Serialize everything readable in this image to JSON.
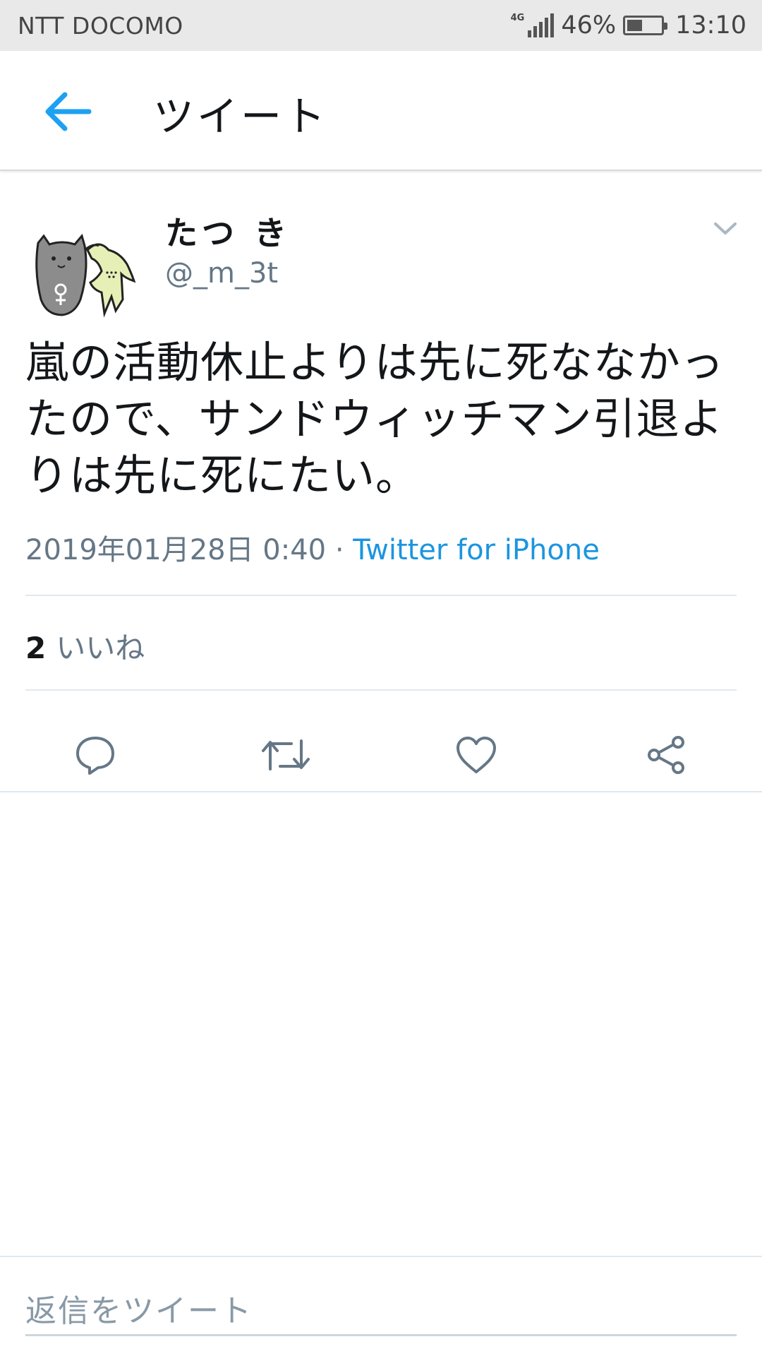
{
  "status_bar": {
    "carrier": "NTT DOCOMO",
    "network": "4G",
    "battery": "46%",
    "battery_level": 0.46,
    "time": "13:10"
  },
  "app_bar": {
    "back_icon": "arrow-left-icon",
    "title": "ツイート"
  },
  "tweet": {
    "user_name": "たつ き",
    "handle": "@_m_3t",
    "text": "嵐の活動休止よりは先に死ななかったので、サンドウィッチマン引退よりは先に死にたい。",
    "timestamp": "2019年01月28日 0:40",
    "separator": " · ",
    "source": "Twitter for iPhone",
    "likes_count": "2",
    "likes_label": "いいね",
    "actions": [
      {
        "name": "reply",
        "icon": "comment-icon"
      },
      {
        "name": "retweet",
        "icon": "retweet-icon"
      },
      {
        "name": "like",
        "icon": "heart-icon"
      },
      {
        "name": "share",
        "icon": "share-icon"
      }
    ]
  },
  "reply": {
    "placeholder": "返信をツイート"
  },
  "colors": {
    "accent": "#1da1f2",
    "link": "#1b95e0",
    "secondary_text": "#657786",
    "icon_gray": "#657786"
  }
}
